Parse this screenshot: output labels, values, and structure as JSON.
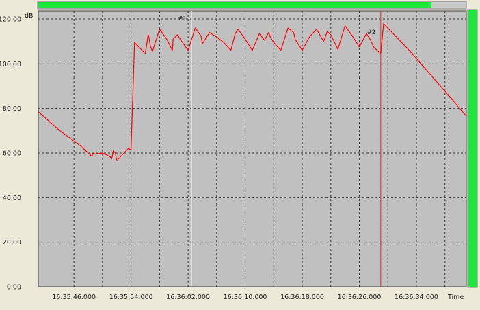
{
  "colors": {
    "background": "#ece9d8",
    "plot_background": "#c0c0c0",
    "series": "#ff0000",
    "progress": "#1ee63c",
    "level": "#1ee63c",
    "marker1": "#e0e0e0",
    "marker2": "#e04040"
  },
  "progress": {
    "fraction": 0.92
  },
  "level_meter": {
    "fraction": 1.0
  },
  "chart_data": {
    "type": "line",
    "ylabel": "dB",
    "xlabel": "Time",
    "ylim": [
      0,
      120
    ],
    "xlim": [
      "16:35:41.000",
      "16:36:41.000"
    ],
    "grid": true,
    "y_ticks": [
      "0.00",
      "20.00",
      "40.00",
      "60.00",
      "80.00",
      "100.00",
      "120.00"
    ],
    "x_ticks": [
      "16:35:46.000",
      "16:35:54.000",
      "16:36:02.000",
      "16:36:10.000",
      "16:36:18.000",
      "16:36:26.000",
      "16:36:34.000"
    ],
    "markers": [
      {
        "label": "#1",
        "x": "16:36:02.500",
        "color": "#e0e0e0"
      },
      {
        "label": "#2",
        "x": "16:36:29.000",
        "color": "#e04040"
      }
    ],
    "series": [
      {
        "x": [
          "16:35:41.000",
          "16:35:44.000",
          "16:35:47.000",
          "16:35:48.000",
          "16:35:48.500",
          "16:35:48.700",
          "16:35:49.000",
          "16:35:50.000",
          "16:35:51.000",
          "16:35:51.300",
          "16:35:51.500",
          "16:35:51.800",
          "16:35:52.000",
          "16:35:53.600",
          "16:35:54.000",
          "16:35:54.500",
          "16:35:56.000",
          "16:35:56.400",
          "16:35:56.500",
          "16:35:56.700",
          "16:35:57.000",
          "16:35:58.000",
          "16:35:59.000",
          "16:35:59.800",
          "16:35:59.900",
          "16:36:00.500",
          "16:36:01.000",
          "16:36:02.000",
          "16:36:03.000",
          "16:36:03.800",
          "16:36:04.000",
          "16:36:05.000",
          "16:36:06.000",
          "16:36:07.000",
          "16:36:08.000",
          "16:36:08.600",
          "16:36:09.000",
          "16:36:10.000",
          "16:36:11.000",
          "16:36:12.000",
          "16:36:12.700",
          "16:36:13.300",
          "16:36:13.500",
          "16:36:14.000",
          "16:36:15.000",
          "16:36:16.000",
          "16:36:16.800",
          "16:36:17.000",
          "16:36:18.000",
          "16:36:19.000",
          "16:36:20.000",
          "16:36:21.000",
          "16:36:21.500",
          "16:36:22.000",
          "16:36:23.000",
          "16:36:24.000",
          "16:36:25.000",
          "16:36:26.000",
          "16:36:27.000",
          "16:36:27.500",
          "16:36:28.000",
          "16:36:29.000",
          "16:36:29.400",
          "16:36:30.000",
          "16:36:33.000",
          "16:36:36.000",
          "16:36:39.000",
          "16:36:41.000"
        ],
        "values": [
          78.5,
          70,
          63,
          60,
          58.5,
          60,
          59.5,
          60,
          58.5,
          57.5,
          61,
          60,
          56.5,
          62,
          61.5,
          109.5,
          104.5,
          113,
          112,
          108,
          105.5,
          115.5,
          111,
          106,
          111,
          113,
          110.5,
          106,
          116,
          112.5,
          109,
          114,
          112,
          109.5,
          106,
          113.5,
          115.5,
          111,
          106,
          113.5,
          110.5,
          114,
          112,
          109.5,
          106,
          116,
          114,
          111,
          106,
          112,
          115.5,
          110,
          114.5,
          113,
          106.5,
          117,
          112.5,
          107.5,
          113.5,
          111,
          107.5,
          104.5,
          118,
          116,
          106,
          95,
          84,
          76.5
        ]
      }
    ]
  }
}
